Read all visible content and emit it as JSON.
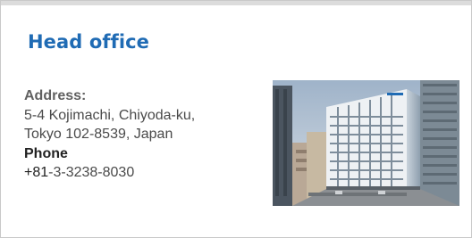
{
  "card": {
    "title": "Head office",
    "address_label": "Address:",
    "address_line1": "5-4 Kojimachi, Chiyoda-ku,",
    "address_line2": "Tokyo 102-8539, Japan",
    "phone_label": "Phone",
    "phone_prefix": "+81",
    "phone_rest": "-3-3238-8030"
  },
  "colors": {
    "title": "#1f6bb4",
    "border": "#c9c9c9",
    "text": "#4a4a4a"
  }
}
